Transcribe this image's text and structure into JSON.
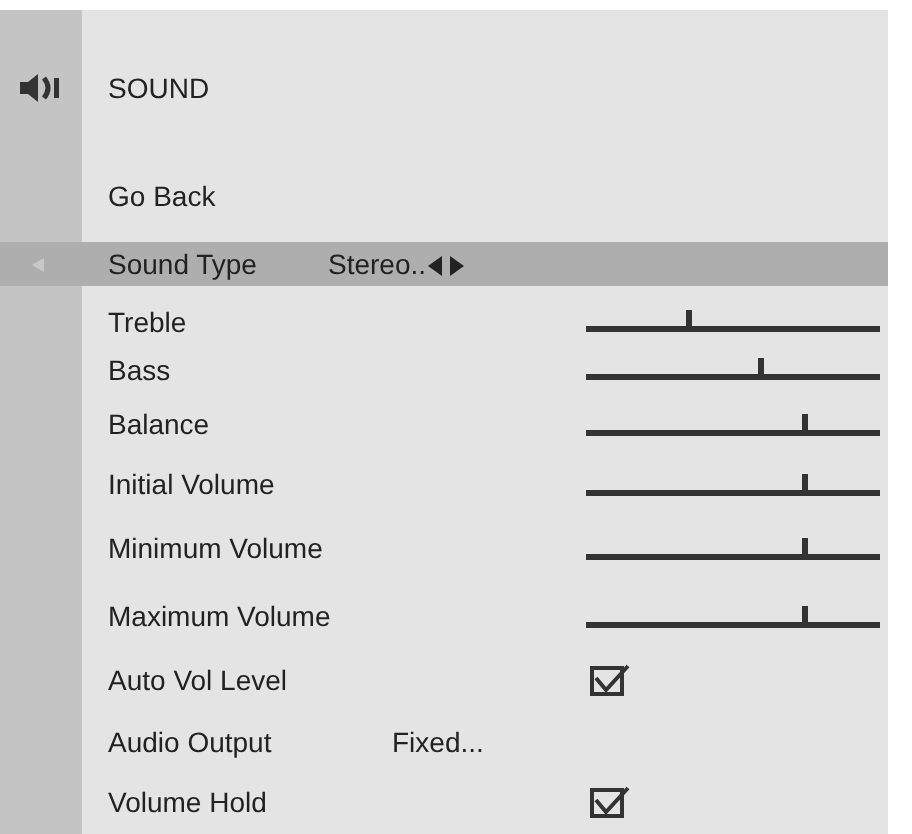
{
  "title": "SOUND",
  "items": [
    {
      "kind": "action",
      "label": "Go Back",
      "selected": false
    },
    {
      "kind": "choice",
      "label": "Sound Type",
      "value": "Stereo..",
      "selected": true
    },
    {
      "kind": "slider",
      "label": "Treble",
      "level": 0.35,
      "selected": false
    },
    {
      "kind": "slider",
      "label": "Bass",
      "level": 0.59,
      "selected": false
    },
    {
      "kind": "slider",
      "label": "Balance",
      "level": 0.74,
      "selected": false
    },
    {
      "kind": "slider",
      "label": "Initial Volume",
      "level": 0.74,
      "selected": false
    },
    {
      "kind": "slider",
      "label": "Minimum Volume",
      "level": 0.74,
      "selected": false
    },
    {
      "kind": "slider",
      "label": "Maximum Volume",
      "level": 0.74,
      "selected": false
    },
    {
      "kind": "checkbox",
      "label": "Auto Vol Level",
      "checked": true,
      "selected": false
    },
    {
      "kind": "value",
      "label": "Audio Output",
      "value": "Fixed...",
      "selected": false
    },
    {
      "kind": "checkbox",
      "label": "Volume Hold",
      "checked": true,
      "selected": false
    }
  ]
}
